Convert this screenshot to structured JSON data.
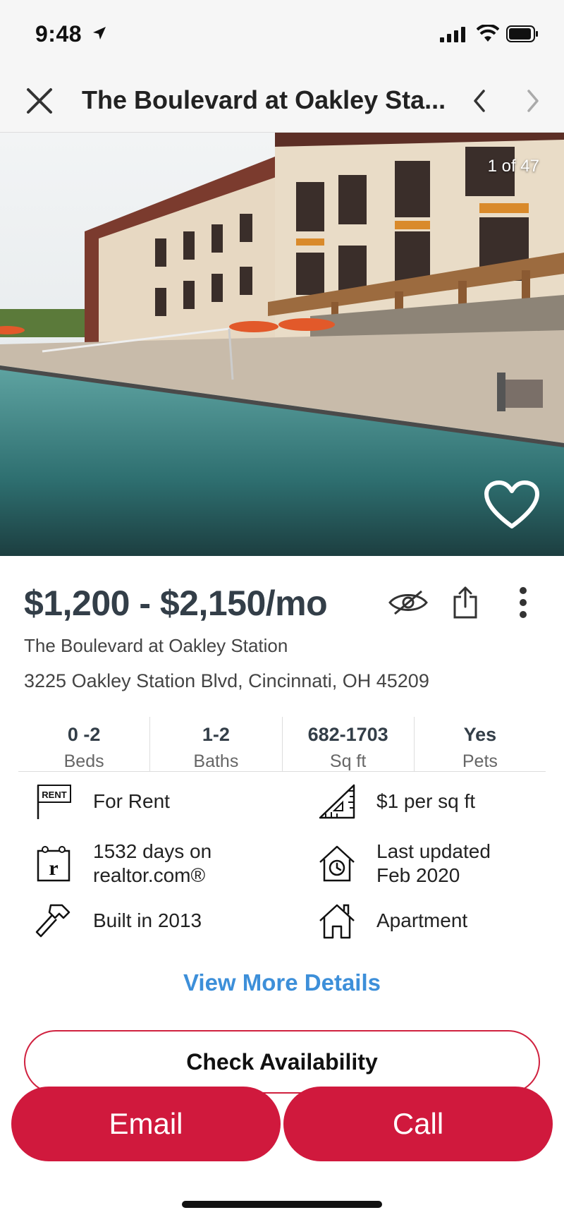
{
  "status_bar": {
    "time": "9:48"
  },
  "nav": {
    "title": "The Boulevard at Oakley Sta..."
  },
  "photo": {
    "counter": "1 of 47"
  },
  "listing": {
    "price": "$1,200 - $2,150/mo",
    "name": "The Boulevard at Oakley Station",
    "address": "3225 Oakley Station Blvd, Cincinnati, OH 45209"
  },
  "stats": [
    {
      "value": "0 -2",
      "label": "Beds"
    },
    {
      "value": "1-2",
      "label": "Baths"
    },
    {
      "value": "682-1703",
      "label": "Sq ft"
    },
    {
      "value": "Yes",
      "label": "Pets"
    }
  ],
  "facts": {
    "status": "For Rent",
    "price_per_sqft": "$1 per sq ft",
    "days_on": "1532 days on\nrealtor.com®",
    "updated": "Last updated\nFeb 2020",
    "built": "Built in 2013",
    "type": "Apartment",
    "rent_sign_text": "RENT"
  },
  "actions": {
    "view_more": "View More Details",
    "check": "Check Availability",
    "email": "Email",
    "call": "Call"
  },
  "colors": {
    "brand_red": "#d0193d",
    "link_blue": "#3d8fd9",
    "price_text": "#333e48"
  }
}
